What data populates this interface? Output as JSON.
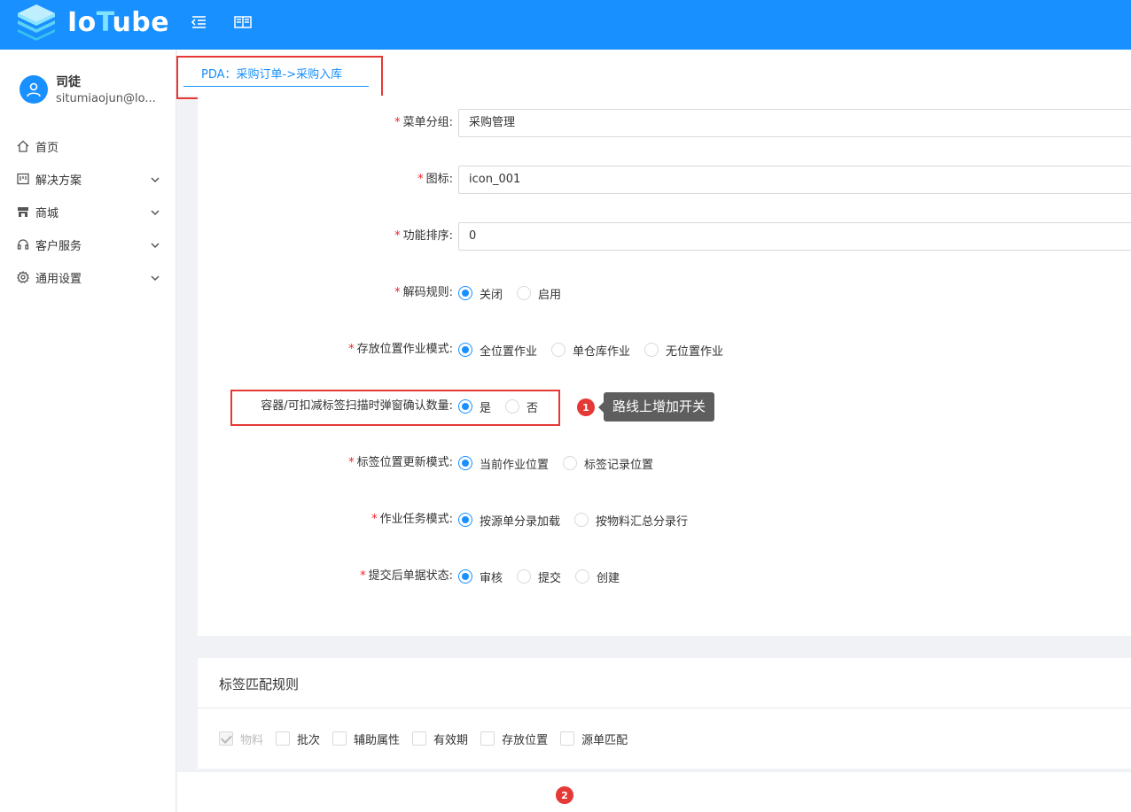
{
  "header": {
    "logo_prefix": "Io",
    "logo_highlight": "T",
    "logo_suffix": "ube",
    "brand_color": "#1890ff",
    "icons": [
      "menu-fold-icon",
      "book-icon"
    ]
  },
  "user": {
    "name": "司徒",
    "email": "situmiaojun@lo..."
  },
  "sidebar": {
    "items": [
      {
        "label": "首页",
        "icon": "home-icon"
      },
      {
        "label": "解决方案",
        "icon": "project-icon"
      },
      {
        "label": "商城",
        "icon": "shop-icon"
      },
      {
        "label": "客户服务",
        "icon": "headset-icon"
      },
      {
        "label": "通用设置",
        "icon": "gear-icon"
      }
    ]
  },
  "tabs": {
    "active": "PDA：采购订单->采购入库"
  },
  "form": {
    "menu_group": {
      "label": "菜单分组:",
      "value": "采购管理"
    },
    "icon": {
      "label": "图标:",
      "value": "icon_001"
    },
    "sort": {
      "label": "功能排序:",
      "value": "0"
    },
    "decode_rule": {
      "label": "解码规则:",
      "options": [
        "关闭",
        "启用"
      ],
      "selected": "关闭"
    },
    "storage_mode": {
      "label": "存放位置作业模式:",
      "options": [
        "全位置作业",
        "单仓库作业",
        "无位置作业"
      ],
      "selected": "全位置作业"
    },
    "container_confirm": {
      "label": "容器/可扣减标签扫描时弹窗确认数量:",
      "options": [
        "是",
        "否"
      ],
      "selected": "是"
    },
    "label_position": {
      "label": "标签位置更新模式:",
      "options": [
        "当前作业位置",
        "标签记录位置"
      ],
      "selected": "当前作业位置"
    },
    "task_mode": {
      "label": "作业任务模式:",
      "options": [
        "按源单分录加载",
        "按物料汇总分录行"
      ],
      "selected": "按源单分录加载"
    },
    "submit_status": {
      "label": "提交后单据状态:",
      "options": [
        "审核",
        "提交",
        "创建"
      ],
      "selected": "审核"
    }
  },
  "annotations": {
    "badge1": "1",
    "tooltip": "路线上增加开关",
    "badge2": "2",
    "highlight_color": "#e53935"
  },
  "label_match": {
    "title": "标签匹配规则",
    "options": [
      {
        "label": "物料",
        "checked": true,
        "disabled": true
      },
      {
        "label": "批次",
        "checked": false,
        "disabled": false
      },
      {
        "label": "辅助属性",
        "checked": false,
        "disabled": false
      },
      {
        "label": "有效期",
        "checked": false,
        "disabled": false
      },
      {
        "label": "存放位置",
        "checked": false,
        "disabled": false
      },
      {
        "label": "源单匹配",
        "checked": false,
        "disabled": false
      }
    ]
  }
}
